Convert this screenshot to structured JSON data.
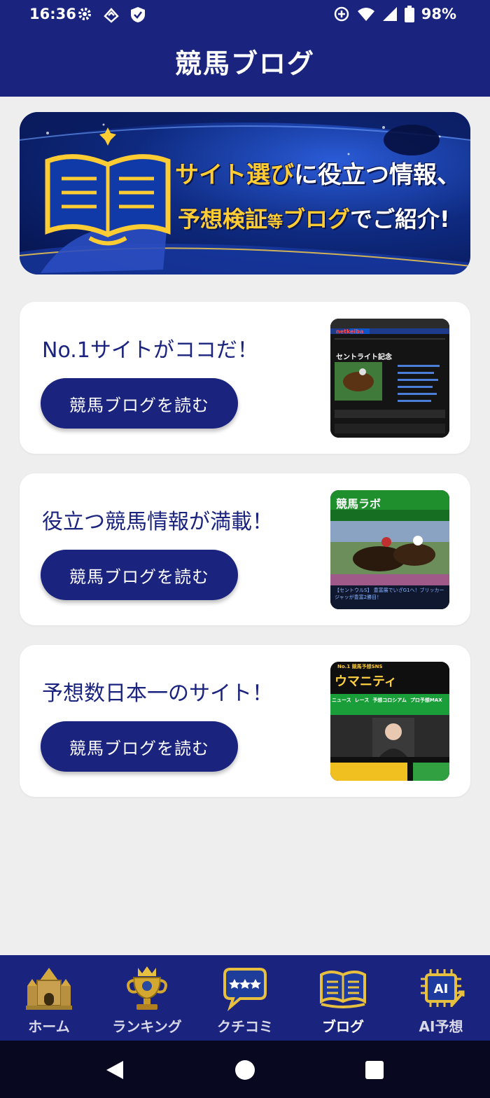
{
  "status_bar": {
    "time": "16:36",
    "battery": "98%",
    "left_icons": [
      "gear-icon",
      "sync-icon",
      "shield-icon"
    ],
    "right_icons": [
      "data-saver-icon",
      "wifi-icon",
      "signal-icon",
      "battery-icon"
    ]
  },
  "header": {
    "title": "競馬ブログ"
  },
  "banner": {
    "line1_highlight": "サイト選び",
    "line1_rest": "に役立つ情報、",
    "line2_highlight1": "予想検証",
    "line2_small": "等",
    "line2_highlight2": "ブログ",
    "line2_rest": "でご紹介!"
  },
  "cards": [
    {
      "title": "No.1サイトがココだ！",
      "button_label": "競馬ブログを読む",
      "thumb_logo": "netkeiba",
      "thumb_headline": "セントライト記念"
    },
    {
      "title": "役立つ競馬情報が満載！",
      "button_label": "競馬ブログを読む",
      "thumb_logo": "競馬ラボ",
      "thumb_caption": "【セントウルS】 豊富展でいざG1へ！ブリッカージャッが豊富2勝目！"
    },
    {
      "title": "予想数日本一のサイト！",
      "button_label": "競馬ブログを読む",
      "thumb_logo": "ウマニティ",
      "thumb_tagline": "No.1 競馬予想SNS",
      "thumb_menu": [
        "ニュース",
        "レース",
        "予想コロシアム",
        "プロ予想MAX"
      ]
    }
  ],
  "bottom_nav": {
    "items": [
      {
        "label": "ホーム",
        "icon": "castle-icon"
      },
      {
        "label": "ランキング",
        "icon": "trophy-icon"
      },
      {
        "label": "クチコミ",
        "icon": "speech-bubble-stars-icon"
      },
      {
        "label": "ブログ",
        "icon": "book-icon",
        "active": true
      },
      {
        "label": "AI予想",
        "icon": "ai-chip-icon"
      }
    ]
  },
  "colors": {
    "primary": "#1a237e",
    "background": "#eeeeee",
    "gold": "#ffcc33"
  }
}
